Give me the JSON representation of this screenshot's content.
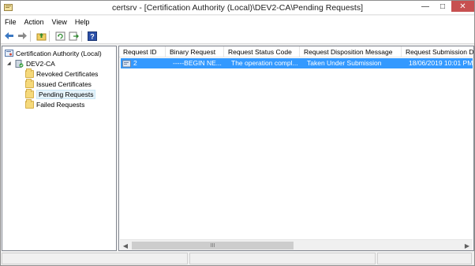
{
  "window": {
    "title": "certsrv - [Certification Authority (Local)\\DEV2-CA\\Pending Requests]",
    "minimize_glyph": "—",
    "maximize_glyph": "□",
    "close_glyph": "✕"
  },
  "menu": [
    "File",
    "Action",
    "View",
    "Help"
  ],
  "toolbar": {
    "icons": [
      "back-arrow-icon",
      "forward-arrow-icon",
      "up-folder-icon",
      "refresh-icon",
      "export-list-icon",
      "help-icon"
    ]
  },
  "tree": {
    "root": "Certification Authority (Local)",
    "ca": "DEV2-CA",
    "expand_glyph": "◢",
    "folders": [
      "Revoked Certificates",
      "Issued Certificates",
      "Pending Requests",
      "Failed Requests"
    ],
    "selected": "Pending Requests"
  },
  "table": {
    "columns": [
      "Request ID",
      "Binary Request",
      "Request Status Code",
      "Request Disposition Message",
      "Request Submission D"
    ],
    "rows": [
      {
        "request_id": "2",
        "binary_request": "-----BEGIN NE...",
        "status_code": "The operation compl...",
        "disposition": "Taken Under Submission",
        "submission_date": "18/06/2019 10:01 PM"
      }
    ]
  },
  "scrollbar": {
    "left_arrow": "◀",
    "right_arrow": "▶",
    "grip": "III"
  },
  "colors": {
    "selection": "#3399ff",
    "tree_selection": "#e5f3fb",
    "close_button": "#c75050"
  }
}
